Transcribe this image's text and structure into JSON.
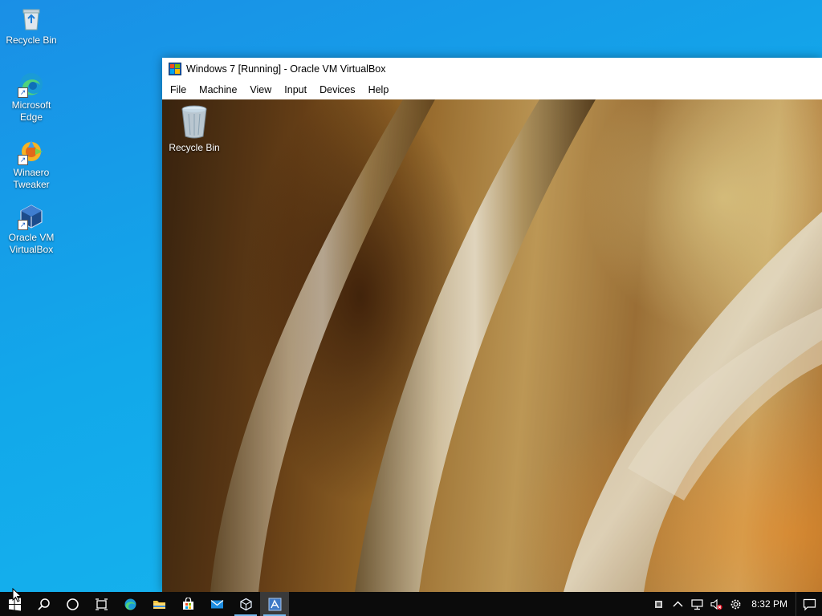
{
  "desktop": {
    "icons": [
      {
        "label": "Recycle Bin",
        "icon": "recycle-bin-icon"
      },
      {
        "label": "Microsoft Edge",
        "icon": "edge-icon"
      },
      {
        "label": "Winaero Tweaker",
        "icon": "winaero-tweaker-icon"
      },
      {
        "label": "Oracle VM VirtualBox",
        "icon": "virtualbox-icon"
      }
    ]
  },
  "vbox": {
    "title": "Windows 7 [Running] - Oracle VM VirtualBox",
    "menu": [
      "File",
      "Machine",
      "View",
      "Input",
      "Devices",
      "Help"
    ],
    "guest_icon_label": "Recycle Bin"
  },
  "taskbar": {
    "buttons": [
      "start-icon",
      "search-icon",
      "cortana-icon",
      "task-view-icon",
      "edge-icon",
      "file-explorer-icon",
      "store-icon",
      "mail-icon",
      "virtualbox-icon",
      "virtualbox-vm-icon"
    ],
    "tray": [
      "vm-indicator-icon",
      "chevron-up-icon",
      "network-icon",
      "volume-muted-icon",
      "settings-icon"
    ],
    "clock": "8:32 PM"
  },
  "colors": {
    "desktop_blue": "#12a8ea",
    "taskbar": "#0b0b0b",
    "accent": "#76b9ed"
  }
}
